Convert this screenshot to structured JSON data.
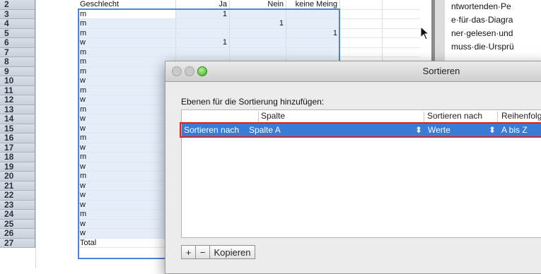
{
  "sheet": {
    "rows": [
      {
        "n": "2",
        "a": "Geschlecht",
        "b": "Ja",
        "c": "Nein",
        "d": "keine Meing"
      },
      {
        "n": "3",
        "a": "m",
        "b": "1",
        "c": "",
        "d": ""
      },
      {
        "n": "4",
        "a": "m",
        "b": "",
        "c": "1",
        "d": ""
      },
      {
        "n": "5",
        "a": "m",
        "b": "",
        "c": "",
        "d": "1"
      },
      {
        "n": "6",
        "a": "w",
        "b": "1",
        "c": "",
        "d": ""
      },
      {
        "n": "7",
        "a": "m",
        "b": "",
        "c": "",
        "d": ""
      },
      {
        "n": "8",
        "a": "m",
        "b": "",
        "c": "",
        "d": ""
      },
      {
        "n": "9",
        "a": "m",
        "b": "",
        "c": "",
        "d": ""
      },
      {
        "n": "10",
        "a": "w",
        "b": "",
        "c": "",
        "d": ""
      },
      {
        "n": "11",
        "a": "m",
        "b": "",
        "c": "",
        "d": ""
      },
      {
        "n": "12",
        "a": "w",
        "b": "",
        "c": "",
        "d": ""
      },
      {
        "n": "13",
        "a": "m",
        "b": "",
        "c": "",
        "d": ""
      },
      {
        "n": "14",
        "a": "w",
        "b": "",
        "c": "",
        "d": ""
      },
      {
        "n": "15",
        "a": "w",
        "b": "",
        "c": "",
        "d": ""
      },
      {
        "n": "16",
        "a": "m",
        "b": "",
        "c": "",
        "d": ""
      },
      {
        "n": "17",
        "a": "w",
        "b": "",
        "c": "",
        "d": ""
      },
      {
        "n": "18",
        "a": "m",
        "b": "",
        "c": "",
        "d": ""
      },
      {
        "n": "19",
        "a": "w",
        "b": "",
        "c": "",
        "d": ""
      },
      {
        "n": "20",
        "a": "m",
        "b": "",
        "c": "",
        "d": ""
      },
      {
        "n": "21",
        "a": "w",
        "b": "",
        "c": "",
        "d": ""
      },
      {
        "n": "22",
        "a": "w",
        "b": "",
        "c": "",
        "d": ""
      },
      {
        "n": "23",
        "a": "w",
        "b": "",
        "c": "",
        "d": ""
      },
      {
        "n": "24",
        "a": "m",
        "b": "",
        "c": "",
        "d": ""
      },
      {
        "n": "25",
        "a": "w",
        "b": "",
        "c": "",
        "d": ""
      },
      {
        "n": "26",
        "a": "w",
        "b": "",
        "c": "",
        "d": ""
      },
      {
        "n": "27",
        "a": "Total",
        "b": "",
        "c": "",
        "d": ""
      }
    ]
  },
  "doc": {
    "lines": [
      "ntwortenden·Pe",
      "e·für·das·Diagra",
      "ner·gelesen·und",
      "muss·die·Ursprü"
    ]
  },
  "dialog": {
    "title": "Sortieren",
    "instruction": "Ebenen für die Sortierung hinzufügen:",
    "columns": {
      "spalte": "Spalte",
      "sort_by": "Sortieren nach",
      "order": "Reihenfolge"
    },
    "row": {
      "label": "Sortieren nach",
      "spalte": "Spalte A",
      "sort_by": "Werte",
      "order": "A bis Z",
      "stepper": "⬍"
    },
    "buttons": {
      "add": "+",
      "remove": "−",
      "copy": "Kopieren"
    }
  },
  "colors": {
    "selection": "#3a7bd5",
    "highlight": "#d7262b",
    "range_border": "#4d84d6"
  }
}
